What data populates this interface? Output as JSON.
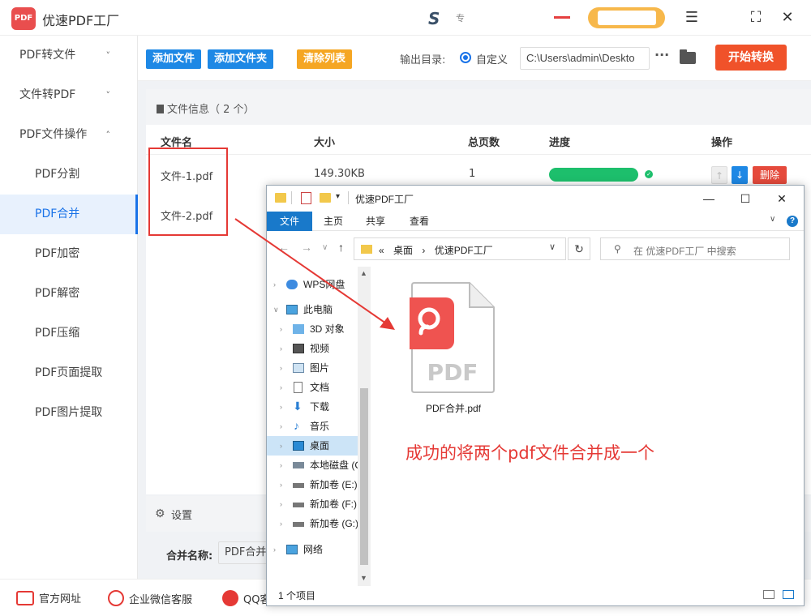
{
  "app": {
    "title": "优速PDF工厂",
    "logo_text": "PDF"
  },
  "titlebar": {
    "s_glyph": "S",
    "small_text": "专"
  },
  "sidebar": {
    "items": [
      {
        "label": "PDF转文件",
        "type": "group",
        "chevron": "˅"
      },
      {
        "label": "文件转PDF",
        "type": "group",
        "chevron": "˅"
      },
      {
        "label": "PDF文件操作",
        "type": "group",
        "chevron": "˄"
      },
      {
        "label": "PDF分割",
        "type": "sub"
      },
      {
        "label": "PDF合并",
        "type": "sub",
        "active": true
      },
      {
        "label": "PDF加密",
        "type": "sub"
      },
      {
        "label": "PDF解密",
        "type": "sub"
      },
      {
        "label": "PDF压缩",
        "type": "sub"
      },
      {
        "label": "PDF页面提取",
        "type": "sub"
      },
      {
        "label": "PDF图片提取",
        "type": "sub"
      }
    ]
  },
  "toolbar": {
    "add_file": "添加文件",
    "add_folder": "添加文件夹",
    "clear_list": "清除列表",
    "output_label": "输出目录:",
    "radio_label": "自定义",
    "output_path": "C:\\Users\\admin\\Deskto",
    "more": "···",
    "start": "开始转换"
  },
  "file_list": {
    "header": "文件信息（ 2 个）",
    "columns": {
      "name": "文件名",
      "size": "大小",
      "pages": "总页数",
      "progress": "进度",
      "action": "操作"
    },
    "rows": [
      {
        "name": "文件-1.pdf",
        "size": "149.30KB",
        "pages": "1",
        "progress": 1.0
      },
      {
        "name": "文件-2.pdf"
      }
    ],
    "delete": "删除"
  },
  "settings": {
    "title": "设置",
    "merge_name_label": "合并名称:",
    "merge_name_value": "PDF合并"
  },
  "footer": {
    "website": "官方网址",
    "wechat": "企业微信客服",
    "qq": "QQ客服"
  },
  "explorer": {
    "title": "优速PDF工厂",
    "ribbon_tabs": [
      "文件",
      "主页",
      "共享",
      "查看"
    ],
    "address": [
      "«",
      "桌面",
      "›",
      "优速PDF工厂"
    ],
    "search_placeholder": "在 优速PDF工厂 中搜索",
    "tree": [
      {
        "label": "WPS网盘",
        "icon": "cloud-icon",
        "indent": 0
      },
      {
        "label": "此电脑",
        "icon": "computer-icon",
        "indent": 0,
        "expanded": true
      },
      {
        "label": "3D 对象",
        "icon": "3d-objects-icon",
        "indent": 1
      },
      {
        "label": "视频",
        "icon": "video-icon",
        "indent": 1
      },
      {
        "label": "图片",
        "icon": "pictures-icon",
        "indent": 1
      },
      {
        "label": "文档",
        "icon": "documents-icon",
        "indent": 1
      },
      {
        "label": "下载",
        "icon": "download-icon",
        "indent": 1
      },
      {
        "label": "音乐",
        "icon": "music-icon",
        "indent": 1
      },
      {
        "label": "桌面",
        "icon": "desktop-icon",
        "indent": 1,
        "selected": true
      },
      {
        "label": "本地磁盘 (C:)",
        "icon": "drive-icon",
        "indent": 1
      },
      {
        "label": "新加卷 (E:)",
        "icon": "drive-icon",
        "indent": 1
      },
      {
        "label": "新加卷 (F:)",
        "icon": "drive-icon",
        "indent": 1
      },
      {
        "label": "新加卷 (G:)",
        "icon": "drive-icon",
        "indent": 1
      },
      {
        "label": "网络",
        "icon": "network-icon",
        "indent": 0
      }
    ],
    "file_name": "PDF合并.pdf",
    "file_icon_text": "PDF",
    "status": "1 个项目"
  },
  "annotation": "成功的将两个pdf文件合并成一个",
  "colors": {
    "accent_blue": "#1e88e5",
    "start_red": "#f0522a",
    "progress_green": "#1dbf6c",
    "annotation_red": "#e53935",
    "brand_red": "#e94e4e"
  }
}
